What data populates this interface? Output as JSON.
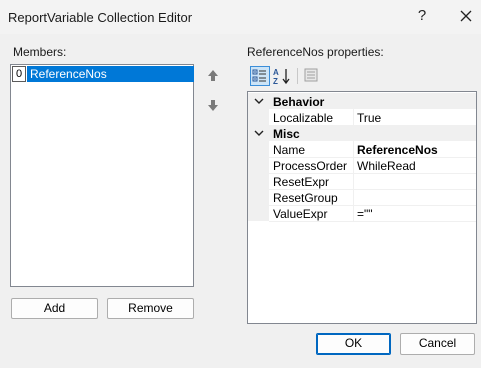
{
  "window": {
    "title": "ReportVariable Collection Editor",
    "help_glyph": "?"
  },
  "members": {
    "label": "Members:",
    "items": [
      {
        "index": "0",
        "name": "ReferenceNos"
      }
    ],
    "add_label": "Add",
    "remove_label": "Remove"
  },
  "properties": {
    "label": "ReferenceNos properties:",
    "toolbar": {
      "categorized_icon": "categorized-icon",
      "alphabetical_icon": "alphabetical-icon",
      "property-pages_icon": "property-pages-icon"
    },
    "categories": [
      {
        "name": "Behavior",
        "rows": [
          {
            "name": "Localizable",
            "value": "True",
            "bold": false
          }
        ]
      },
      {
        "name": "Misc",
        "rows": [
          {
            "name": "Name",
            "value": "ReferenceNos",
            "bold": true
          },
          {
            "name": "ProcessOrder",
            "value": "WhileRead",
            "bold": false
          },
          {
            "name": "ResetExpr",
            "value": "",
            "bold": false
          },
          {
            "name": "ResetGroup",
            "value": "",
            "bold": false
          },
          {
            "name": "ValueExpr",
            "value": "=\"\"",
            "bold": false
          }
        ]
      }
    ]
  },
  "footer": {
    "ok_label": "OK",
    "cancel_label": "Cancel"
  },
  "colors": {
    "selection": "#0078d7",
    "dialog_bg": "#f0f0f0",
    "default_button_border": "#0067c0"
  }
}
